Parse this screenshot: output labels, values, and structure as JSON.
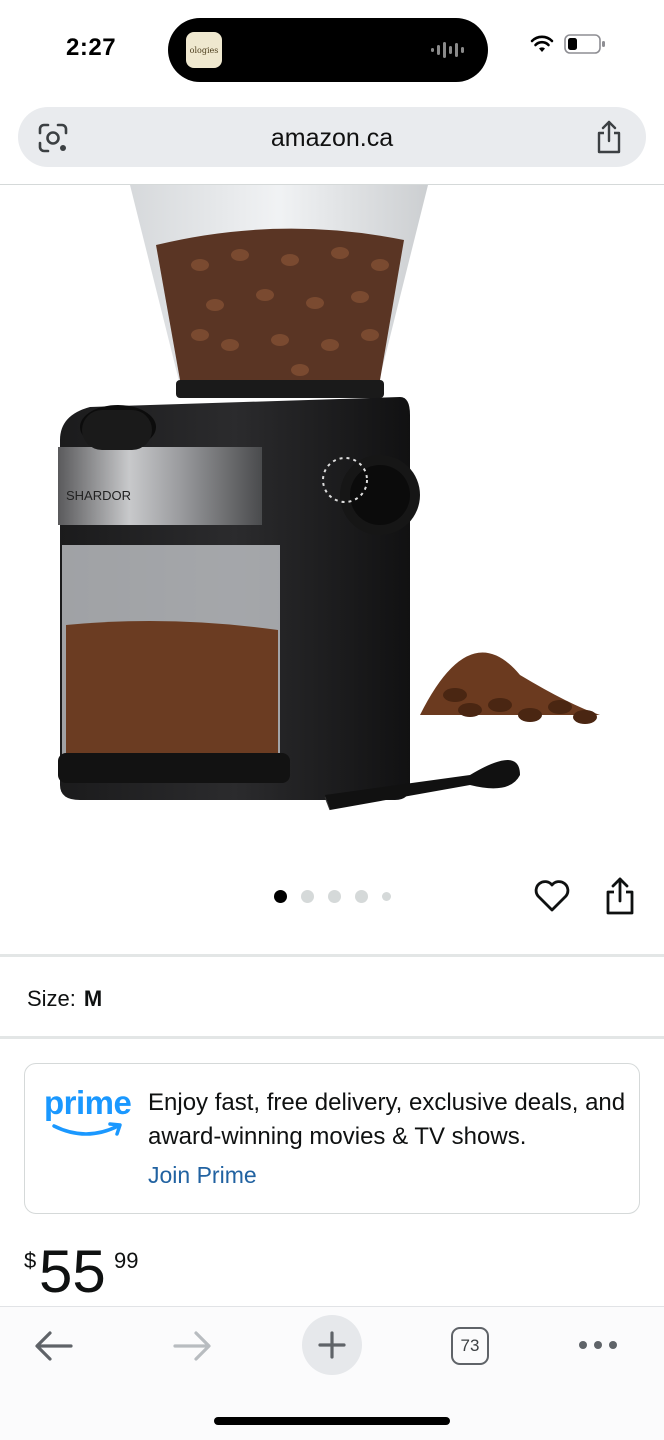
{
  "status_bar": {
    "time": "2:27",
    "island_app_label": "ologies"
  },
  "browser": {
    "url": "amazon.ca",
    "tab_count": "73"
  },
  "product": {
    "image_alt": "SHARDOR burr coffee grinder",
    "brand_on_product": "SHARDOR",
    "carousel": {
      "total_images": 5,
      "active_index": 0
    },
    "size_label": "Size:",
    "size_value": "M"
  },
  "prime_banner": {
    "logo_text": "prime",
    "text": "Enjoy fast, free delivery, exclusive deals, and award-winning movies & TV shows.",
    "link": "Join Prime",
    "brand_color": "#1a98ff",
    "link_color": "#2162a1"
  },
  "price": {
    "currency": "$",
    "whole": "55",
    "fraction": "99"
  },
  "icons": {
    "lens": "google-lens-icon",
    "share": "share-icon",
    "wishlist": "heart-icon",
    "back": "arrow-left-icon",
    "forward": "arrow-right-icon",
    "new_tab": "plus-icon",
    "tabs": "tab-switcher-icon",
    "more": "more-dots-icon"
  }
}
